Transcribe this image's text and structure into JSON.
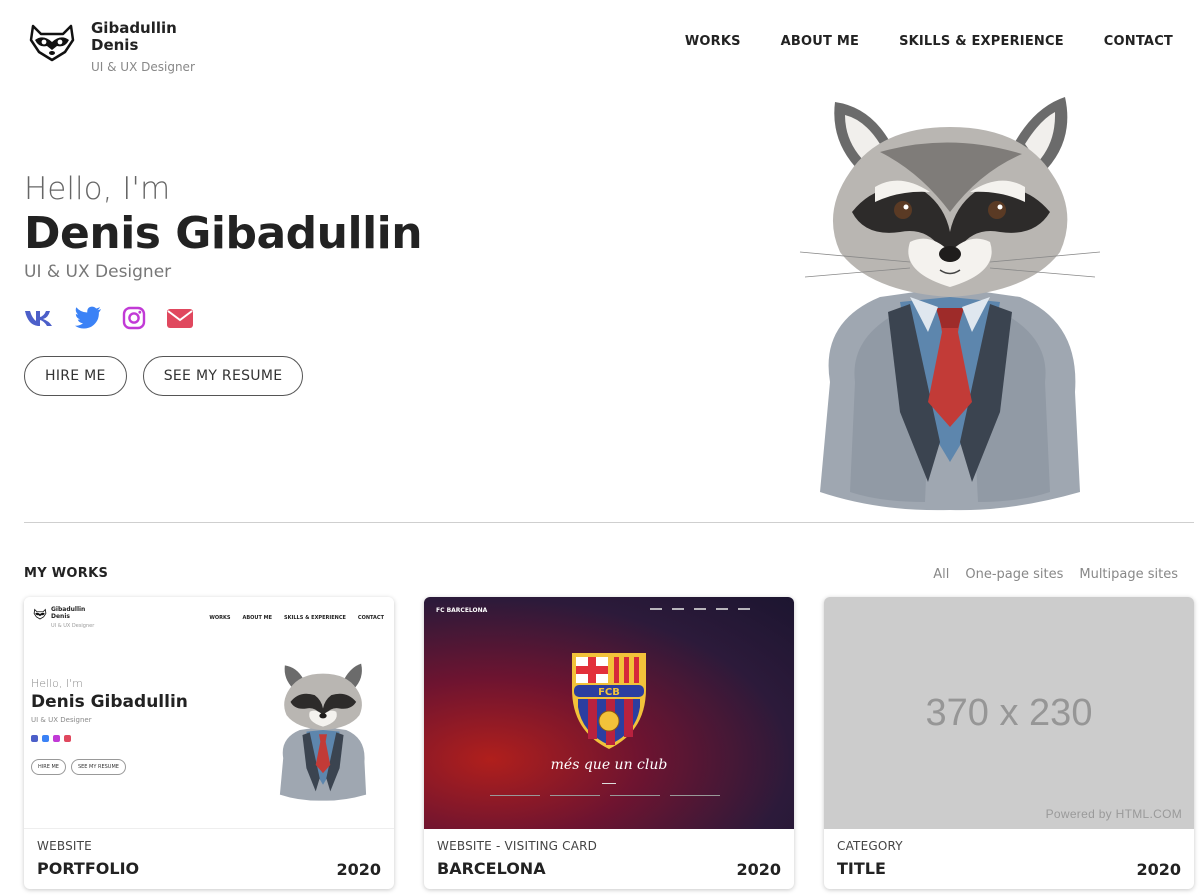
{
  "header": {
    "logo_name_line1": "Gibadullin",
    "logo_name_line2": "Denis",
    "logo_role": "UI & UX Designer",
    "nav": [
      "WORKS",
      "ABOUT ME",
      "SKILLS & EXPERIENCE",
      "CONTACT"
    ]
  },
  "hero": {
    "greeting": "Hello, I'm",
    "name": "Denis Gibadullin",
    "role": "UI & UX Designer",
    "socials": [
      {
        "icon": "vk-icon",
        "color": "#4c5fc9"
      },
      {
        "icon": "twitter-icon",
        "color": "#3b82f6"
      },
      {
        "icon": "instagram-icon",
        "color": "#c13ad6"
      },
      {
        "icon": "mail-icon",
        "color": "#e0485e"
      }
    ],
    "hire_label": "HIRE ME",
    "resume_label": "SEE MY RESUME"
  },
  "works": {
    "title": "MY WORKS",
    "filters": [
      "All",
      "One-page sites",
      "Multipage sites"
    ],
    "cards": [
      {
        "category": "WEBSITE",
        "title": "PORTFOLIO",
        "year": "2020",
        "thumb": {
          "logo_line1": "Gibadullin",
          "logo_line2": "Denis",
          "role": "UI & UX Designer",
          "nav": [
            "WORKS",
            "ABOUT ME",
            "SKILLS & EXPERIENCE",
            "CONTACT"
          ],
          "greeting": "Hello, I'm",
          "name": "Denis Gibadullin",
          "sub": "UI & UX Designer",
          "btn1": "HIRE ME",
          "btn2": "SEE MY RESUME"
        }
      },
      {
        "category": "WEBSITE - VISITING CARD",
        "title": "BARCELONA",
        "year": "2020",
        "thumb": {
          "club": "FC BARCELONA",
          "crest_letters": "FCB",
          "motto": "més que un club"
        }
      },
      {
        "category": "CATEGORY",
        "title": "TITLE",
        "year": "2020",
        "thumb": {
          "placeholder": "370 x 230",
          "powered": "Powered by HTML.COM"
        }
      }
    ]
  }
}
